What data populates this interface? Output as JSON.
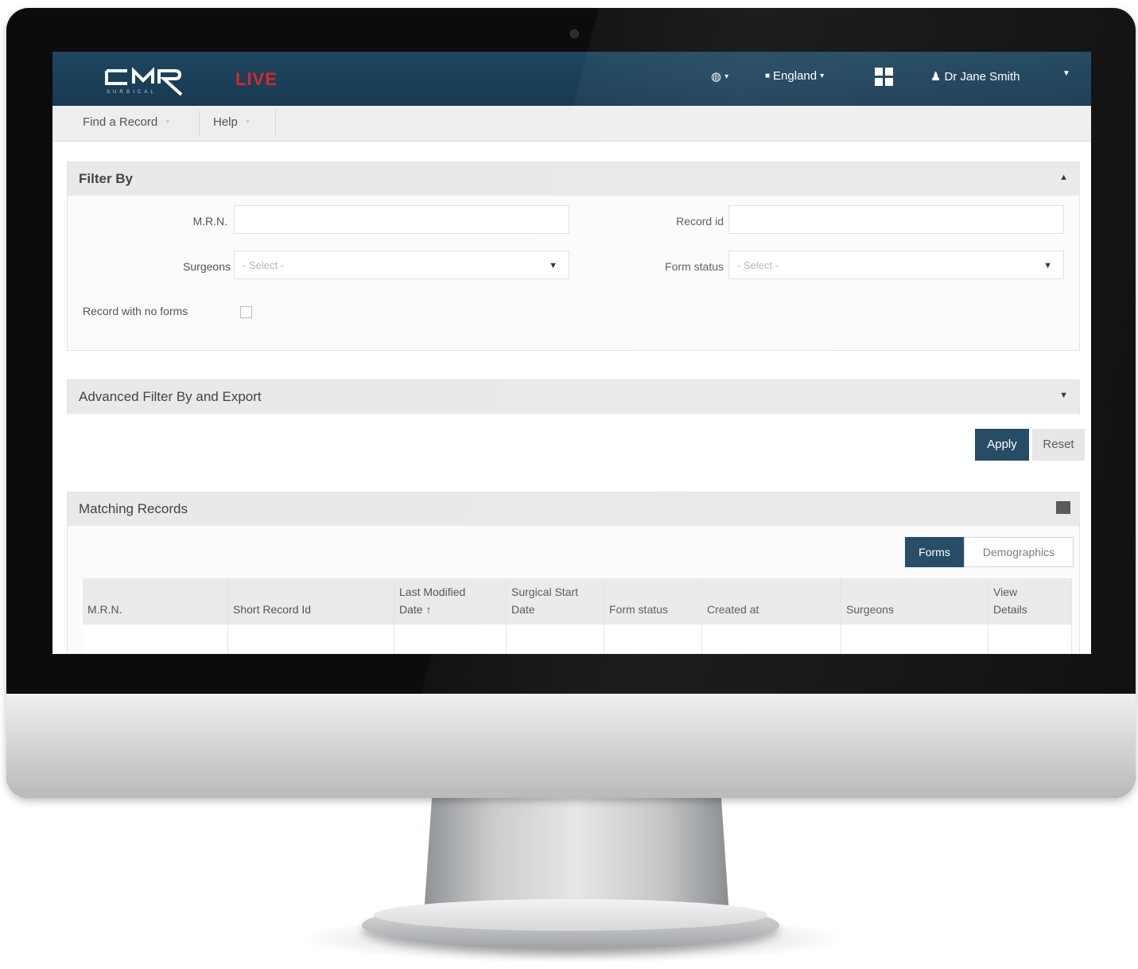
{
  "app": {
    "logo_text": "CMR",
    "logo_subtext": "SURGICAL",
    "environment": "LIVE"
  },
  "topbar": {
    "globe_icon": "globe-icon",
    "country": "England",
    "apps_icon": "grid-icon",
    "user_icon": "user-icon",
    "user_name": "Dr Jane Smith"
  },
  "subnav": {
    "items": [
      {
        "label": "Find a Record"
      },
      {
        "label": "Help"
      }
    ]
  },
  "filter": {
    "title": "Filter By",
    "mrn_label": "M.R.N.",
    "mrn_value": "",
    "record_id_label": "Record id",
    "record_id_value": "",
    "surgeons_label": "Surgeons",
    "surgeons_placeholder": "- Select -",
    "form_status_label": "Form status",
    "form_status_placeholder": "- Select -",
    "no_forms_label": "Record with no forms",
    "no_forms_checked": false
  },
  "advanced": {
    "title": "Advanced Filter By and Export",
    "apply_label": "Apply",
    "reset_label": "Reset"
  },
  "records": {
    "title": "Matching Records",
    "toggle_forms": "Forms",
    "toggle_demographics": "Demographics",
    "columns": [
      {
        "line1": "",
        "line2": "M.R.N."
      },
      {
        "line1": "",
        "line2": "Short Record Id"
      },
      {
        "line1": "Last Modified",
        "line2": "Date ↑"
      },
      {
        "line1": "Surgical Start",
        "line2": "Date"
      },
      {
        "line1": "",
        "line2": "Form status"
      },
      {
        "line1": "",
        "line2": "Created at"
      },
      {
        "line1": "",
        "line2": "Surgeons"
      },
      {
        "line1": "View",
        "line2": "Details"
      }
    ]
  },
  "colors": {
    "brand": "#1f4560",
    "live": "#d9262b"
  }
}
